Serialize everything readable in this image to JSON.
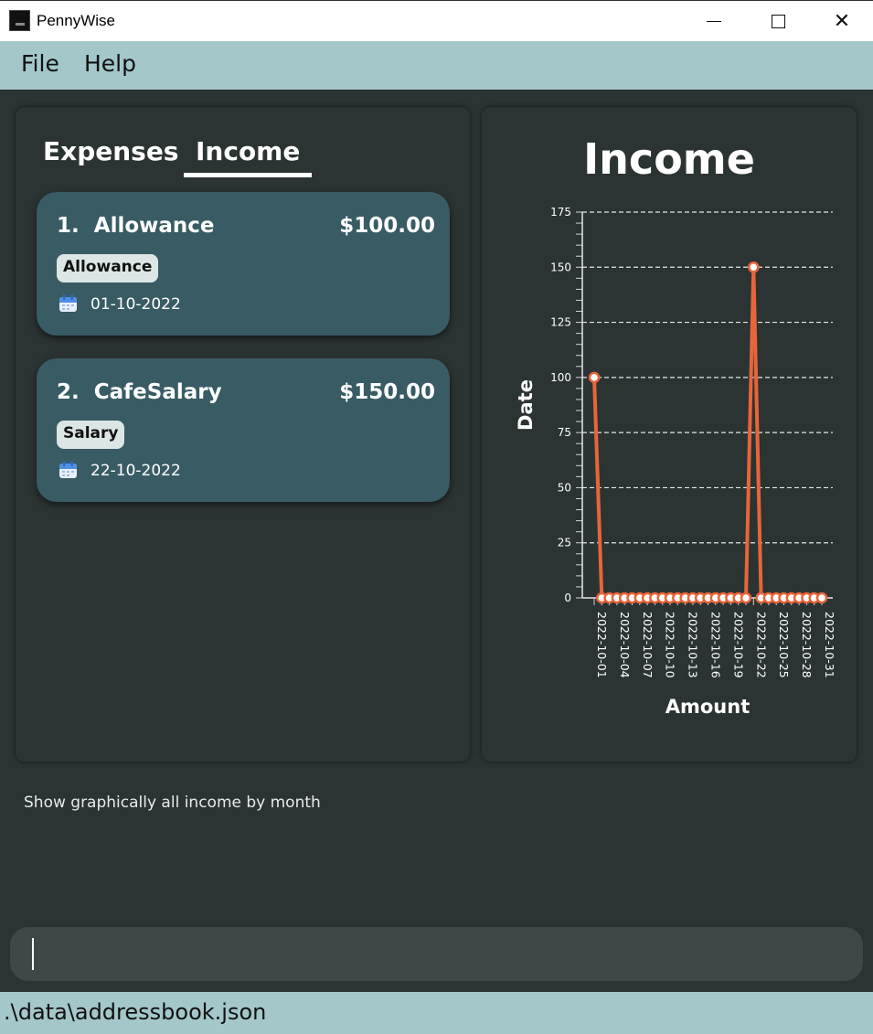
{
  "window": {
    "title": "PennyWise",
    "minimize_glyph": "",
    "maximize_glyph": "",
    "close_glyph": "✕"
  },
  "menu": {
    "file": "File",
    "help": "Help"
  },
  "tabs": [
    {
      "label": "Expenses",
      "selected": false
    },
    {
      "label": "Income",
      "selected": true
    }
  ],
  "entries": [
    {
      "index": "1.",
      "name": "Allowance",
      "amount": "$100.00",
      "tag": "Allowance",
      "date": "01-10-2022",
      "icon": "calendar-icon"
    },
    {
      "index": "2.",
      "name": "CafeSalary",
      "amount": "$150.00",
      "tag": "Salary",
      "date": "22-10-2022",
      "icon": "calendar-icon"
    }
  ],
  "result_message": "Show graphically all income by month",
  "command_input": {
    "value": "",
    "placeholder": ""
  },
  "status": {
    "path": ".\\data\\addressbook.json"
  },
  "colors": {
    "background": "#2c3333",
    "card": "#395b64",
    "menubar": "#a4c7ca",
    "chart_line": "#e8653a"
  },
  "chart_data": {
    "type": "line",
    "title": "Income",
    "xlabel": "Amount",
    "ylabel": "Date",
    "ylim": [
      0,
      175
    ],
    "y_ticks": [
      0,
      25,
      50,
      75,
      100,
      125,
      150,
      175
    ],
    "grid": "horizontal dashed",
    "x_tick_labels": [
      "2022-10-01",
      "2022-10-04",
      "2022-10-07",
      "2022-10-10",
      "2022-10-13",
      "2022-10-16",
      "2022-10-19",
      "2022-10-22",
      "2022-10-25",
      "2022-10-28",
      "2022-10-31"
    ],
    "x": [
      "2022-10-01",
      "2022-10-02",
      "2022-10-03",
      "2022-10-04",
      "2022-10-05",
      "2022-10-06",
      "2022-10-07",
      "2022-10-08",
      "2022-10-09",
      "2022-10-10",
      "2022-10-11",
      "2022-10-12",
      "2022-10-13",
      "2022-10-14",
      "2022-10-15",
      "2022-10-16",
      "2022-10-17",
      "2022-10-18",
      "2022-10-19",
      "2022-10-20",
      "2022-10-21",
      "2022-10-22",
      "2022-10-23",
      "2022-10-24",
      "2022-10-25",
      "2022-10-26",
      "2022-10-27",
      "2022-10-28",
      "2022-10-29",
      "2022-10-30",
      "2022-10-31"
    ],
    "series": [
      {
        "values": [
          100,
          0,
          0,
          0,
          0,
          0,
          0,
          0,
          0,
          0,
          0,
          0,
          0,
          0,
          0,
          0,
          0,
          0,
          0,
          0,
          0,
          150,
          0,
          0,
          0,
          0,
          0,
          0,
          0,
          0,
          0
        ]
      }
    ]
  }
}
